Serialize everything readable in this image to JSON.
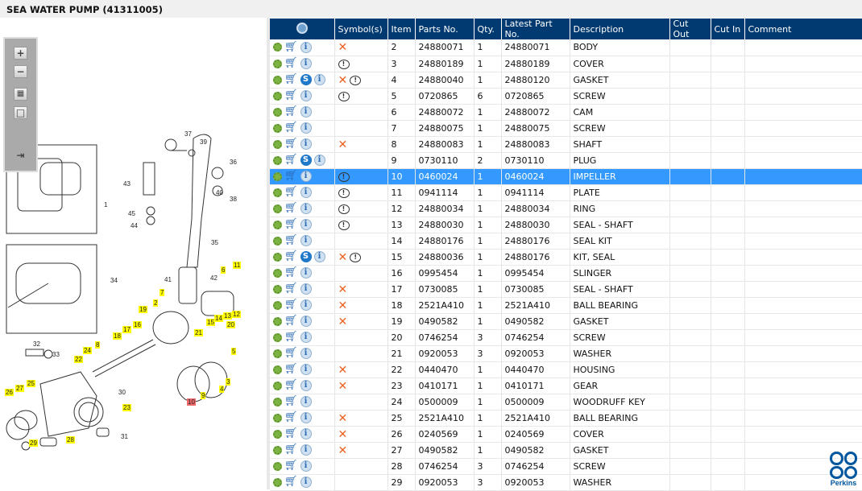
{
  "title": "SEA WATER PUMP (41311005)",
  "toolbar": {
    "zoom_in": "+",
    "zoom_out": "−",
    "fit": "▦",
    "actual": "□",
    "hide": "⇥"
  },
  "columns": [
    "",
    "Symbol(s)",
    "Item",
    "Parts No.",
    "Qty.",
    "Latest Part No.",
    "Description",
    "Cut Out",
    "Cut In",
    "Comment"
  ],
  "rows": [
    {
      "item": "2",
      "parts": "24880071",
      "qty": "1",
      "latest": "24880071",
      "desc": "BODY",
      "s": false,
      "sym": [
        "x"
      ]
    },
    {
      "item": "3",
      "parts": "24880189",
      "qty": "1",
      "latest": "24880189",
      "desc": "COVER",
      "s": false,
      "sym": [
        "c"
      ]
    },
    {
      "item": "4",
      "parts": "24880040",
      "qty": "1",
      "latest": "24880120",
      "desc": "GASKET",
      "s": true,
      "sym": [
        "x",
        "c"
      ]
    },
    {
      "item": "5",
      "parts": "0720865",
      "qty": "6",
      "latest": "0720865",
      "desc": "SCREW",
      "s": false,
      "sym": [
        "c"
      ]
    },
    {
      "item": "6",
      "parts": "24880072",
      "qty": "1",
      "latest": "24880072",
      "desc": "CAM",
      "s": false,
      "sym": []
    },
    {
      "item": "7",
      "parts": "24880075",
      "qty": "1",
      "latest": "24880075",
      "desc": "SCREW",
      "s": false,
      "sym": []
    },
    {
      "item": "8",
      "parts": "24880083",
      "qty": "1",
      "latest": "24880083",
      "desc": "SHAFT",
      "s": false,
      "sym": [
        "x"
      ]
    },
    {
      "item": "9",
      "parts": "0730110",
      "qty": "2",
      "latest": "0730110",
      "desc": "PLUG",
      "s": true,
      "sym": []
    },
    {
      "item": "10",
      "parts": "0460024",
      "qty": "1",
      "latest": "0460024",
      "desc": "IMPELLER",
      "s": false,
      "sym": [
        "c"
      ],
      "selected": true
    },
    {
      "item": "11",
      "parts": "0941114",
      "qty": "1",
      "latest": "0941114",
      "desc": "PLATE",
      "s": false,
      "sym": [
        "c"
      ]
    },
    {
      "item": "12",
      "parts": "24880034",
      "qty": "1",
      "latest": "24880034",
      "desc": "RING",
      "s": false,
      "sym": [
        "c"
      ]
    },
    {
      "item": "13",
      "parts": "24880030",
      "qty": "1",
      "latest": "24880030",
      "desc": "SEAL - SHAFT",
      "s": false,
      "sym": [
        "c"
      ]
    },
    {
      "item": "14",
      "parts": "24880176",
      "qty": "1",
      "latest": "24880176",
      "desc": "SEAL KIT",
      "s": false,
      "sym": []
    },
    {
      "item": "15",
      "parts": "24880036",
      "qty": "1",
      "latest": "24880176",
      "desc": "KIT, SEAL",
      "s": true,
      "sym": [
        "x",
        "c"
      ]
    },
    {
      "item": "16",
      "parts": "0995454",
      "qty": "1",
      "latest": "0995454",
      "desc": "SLINGER",
      "s": false,
      "sym": []
    },
    {
      "item": "17",
      "parts": "0730085",
      "qty": "1",
      "latest": "0730085",
      "desc": "SEAL - SHAFT",
      "s": false,
      "sym": [
        "x"
      ]
    },
    {
      "item": "18",
      "parts": "2521A410",
      "qty": "1",
      "latest": "2521A410",
      "desc": "BALL BEARING",
      "s": false,
      "sym": [
        "x"
      ]
    },
    {
      "item": "19",
      "parts": "0490582",
      "qty": "1",
      "latest": "0490582",
      "desc": "GASKET",
      "s": false,
      "sym": [
        "x"
      ]
    },
    {
      "item": "20",
      "parts": "0746254",
      "qty": "3",
      "latest": "0746254",
      "desc": "SCREW",
      "s": false,
      "sym": []
    },
    {
      "item": "21",
      "parts": "0920053",
      "qty": "3",
      "latest": "0920053",
      "desc": "WASHER",
      "s": false,
      "sym": []
    },
    {
      "item": "22",
      "parts": "0440470",
      "qty": "1",
      "latest": "0440470",
      "desc": "HOUSING",
      "s": false,
      "sym": [
        "x"
      ]
    },
    {
      "item": "23",
      "parts": "0410171",
      "qty": "1",
      "latest": "0410171",
      "desc": "GEAR",
      "s": false,
      "sym": [
        "x"
      ]
    },
    {
      "item": "24",
      "parts": "0500009",
      "qty": "1",
      "latest": "0500009",
      "desc": "WOODRUFF KEY",
      "s": false,
      "sym": []
    },
    {
      "item": "25",
      "parts": "2521A410",
      "qty": "1",
      "latest": "2521A410",
      "desc": "BALL BEARING",
      "s": false,
      "sym": [
        "x"
      ]
    },
    {
      "item": "26",
      "parts": "0240569",
      "qty": "1",
      "latest": "0240569",
      "desc": "COVER",
      "s": false,
      "sym": [
        "x"
      ]
    },
    {
      "item": "27",
      "parts": "0490582",
      "qty": "1",
      "latest": "0490582",
      "desc": "GASKET",
      "s": false,
      "sym": [
        "x"
      ]
    },
    {
      "item": "28",
      "parts": "0746254",
      "qty": "3",
      "latest": "0746254",
      "desc": "SCREW",
      "s": false,
      "sym": []
    },
    {
      "item": "29",
      "parts": "0920053",
      "qty": "3",
      "latest": "0920053",
      "desc": "WASHER",
      "s": false,
      "sym": []
    }
  ],
  "callouts": [
    {
      "t": "37",
      "k": ""
    },
    {
      "t": "39",
      "k": ""
    },
    {
      "t": "36",
      "k": ""
    },
    {
      "t": "40",
      "k": ""
    },
    {
      "t": "38",
      "k": ""
    },
    {
      "t": "43",
      "k": ""
    },
    {
      "t": "45",
      "k": ""
    },
    {
      "t": "44",
      "k": ""
    },
    {
      "t": "1",
      "k": ""
    },
    {
      "t": "35",
      "k": ""
    },
    {
      "t": "34",
      "k": ""
    },
    {
      "t": "41",
      "k": ""
    },
    {
      "t": "42",
      "k": ""
    },
    {
      "t": "32",
      "k": ""
    },
    {
      "t": "33",
      "k": ""
    },
    {
      "t": "30",
      "k": ""
    },
    {
      "t": "31",
      "k": ""
    },
    {
      "t": "11",
      "k": "y"
    },
    {
      "t": "6",
      "k": "y"
    },
    {
      "t": "7",
      "k": "y"
    },
    {
      "t": "2",
      "k": "y"
    },
    {
      "t": "19",
      "k": "y"
    },
    {
      "t": "13",
      "k": "y"
    },
    {
      "t": "14",
      "k": "y"
    },
    {
      "t": "12",
      "k": "y"
    },
    {
      "t": "15",
      "k": "y"
    },
    {
      "t": "20",
      "k": "y"
    },
    {
      "t": "17",
      "k": "y"
    },
    {
      "t": "16",
      "k": "y"
    },
    {
      "t": "18",
      "k": "y"
    },
    {
      "t": "21",
      "k": "y"
    },
    {
      "t": "5",
      "k": "y"
    },
    {
      "t": "8",
      "k": "y"
    },
    {
      "t": "24",
      "k": "y"
    },
    {
      "t": "22",
      "k": "y"
    },
    {
      "t": "25",
      "k": "y"
    },
    {
      "t": "27",
      "k": "y"
    },
    {
      "t": "26",
      "k": "y"
    },
    {
      "t": "23",
      "k": "y"
    },
    {
      "t": "29",
      "k": "y"
    },
    {
      "t": "28",
      "k": "y"
    },
    {
      "t": "3",
      "k": "y"
    },
    {
      "t": "4",
      "k": "y"
    },
    {
      "t": "9",
      "k": "y"
    },
    {
      "t": "10",
      "k": "r"
    }
  ],
  "logo": "Perkins"
}
